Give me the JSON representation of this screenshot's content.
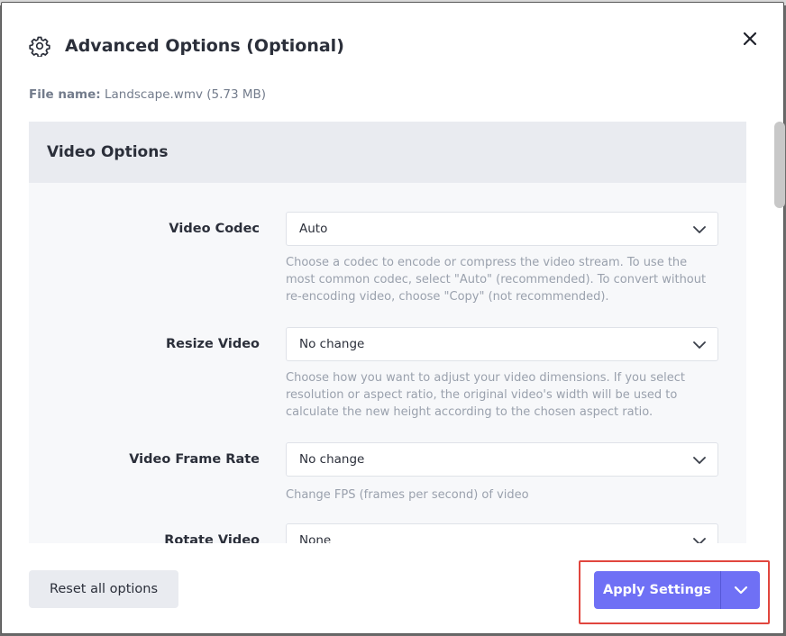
{
  "dialog": {
    "title": "Advanced Options (Optional)",
    "file_label": "File name:",
    "file_value": "Landscape.wmv (5.73 MB)"
  },
  "section": {
    "title": "Video Options"
  },
  "options": [
    {
      "label": "Video Codec",
      "value": "Auto",
      "help": "Choose a codec to encode or compress the video stream. To use the most common codec, select \"Auto\" (recommended). To convert without re-encoding video, choose \"Copy\" (not recommended)."
    },
    {
      "label": "Resize Video",
      "value": "No change",
      "help": "Choose how you want to adjust your video dimensions. If you select resolution or aspect ratio, the original video's width will be used to calculate the new height according to the chosen aspect ratio."
    },
    {
      "label": "Video Frame Rate",
      "value": "No change",
      "help": "Change FPS (frames per second) of video"
    },
    {
      "label": "Rotate Video",
      "value": "None",
      "help": ""
    }
  ],
  "footer": {
    "reset_label": "Reset all options",
    "apply_label": "Apply Settings"
  },
  "colors": {
    "accent": "#6f70f5",
    "highlight": "#e1463e"
  },
  "icons": {
    "header": "gear-icon",
    "close": "close-icon",
    "dropdown": "chevron-down-icon"
  }
}
